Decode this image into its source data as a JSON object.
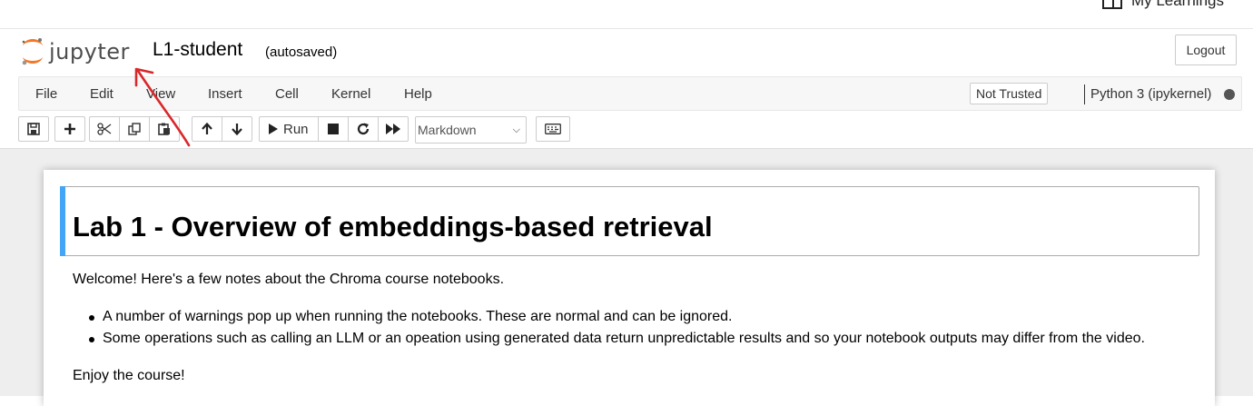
{
  "topbar": {
    "my_learnings": "My Learnings"
  },
  "header": {
    "logo_text": "jupyter",
    "notebook_title": "L1-student",
    "autosave_status": "(autosaved)",
    "logout_label": "Logout"
  },
  "menu": {
    "items": [
      "File",
      "Edit",
      "View",
      "Insert",
      "Cell",
      "Kernel",
      "Help"
    ],
    "trust_status": "Not Trusted",
    "kernel_name": "Python 3 (ipykernel)"
  },
  "toolbar": {
    "run_label": "Run",
    "cell_type": "Markdown",
    "icons": [
      "save-icon",
      "plus-icon",
      "cut-icon",
      "copy-icon",
      "paste-icon",
      "arrow-up-icon",
      "arrow-down-icon",
      "play-icon",
      "stop-icon",
      "restart-icon",
      "fast-forward-icon",
      "keyboard-icon"
    ]
  },
  "notebook": {
    "heading": "Lab 1 - Overview of embeddings-based retrieval",
    "intro": "Welcome! Here's a few notes about the Chroma course notebooks.",
    "bullets": [
      "A number of warnings pop up when running the notebooks. These are normal and can be ignored.",
      "Some operations such as calling an LLM or an opeation using generated data return unpredictable results and so your notebook outputs may differ from the video."
    ],
    "closing": "Enjoy the course!"
  },
  "colors": {
    "jupyter_orange": "#f37726",
    "cell_selected_bar": "#42a5f5",
    "annotation_red": "#d8282c"
  }
}
